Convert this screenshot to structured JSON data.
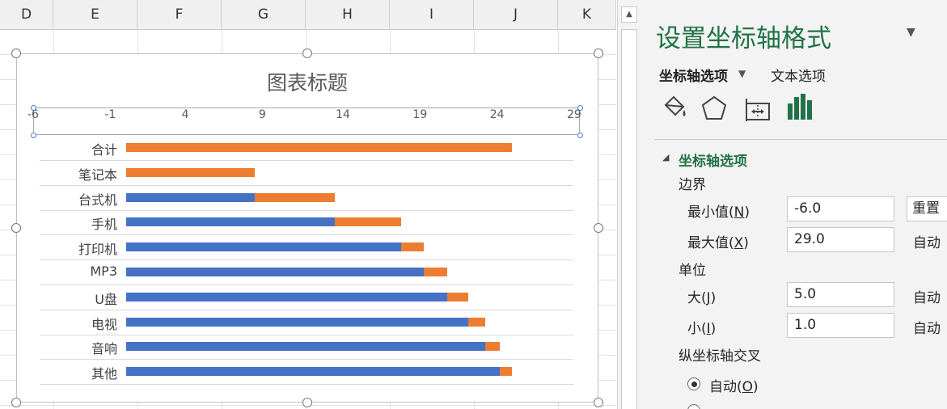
{
  "sheet": {
    "columns": [
      "D",
      "E",
      "F",
      "G",
      "H",
      "I",
      "J",
      "K"
    ]
  },
  "chart": {
    "title": "图表标题",
    "colors": {
      "series1": "#4472c4",
      "series2": "#ed7d31"
    }
  },
  "chart_data": {
    "type": "bar",
    "orientation": "horizontal",
    "stacked": true,
    "title": "图表标题",
    "xlim": [
      -6,
      29
    ],
    "x_ticks": [
      "-6",
      "-1",
      "4",
      "9",
      "14",
      "19",
      "24",
      "29"
    ],
    "categories": [
      "合计",
      "笔记本",
      "台式机",
      "手机",
      "打印机",
      "MP3",
      "U盘",
      "电视",
      "音响",
      "其他"
    ],
    "series": [
      {
        "values": [
          0,
          0,
          8.3,
          13.5,
          17.8,
          19.3,
          20.8,
          22.2,
          23.3,
          24.2
        ],
        "color": "#4472c4"
      },
      {
        "values": [
          25.0,
          8.3,
          5.2,
          4.3,
          1.5,
          1.5,
          1.4,
          1.1,
          0.9,
          0.8
        ],
        "color": "#ed7d31"
      }
    ],
    "grid": true,
    "legend": "none"
  },
  "pane": {
    "title": "设置坐标轴格式",
    "tab_axis": "坐标轴选项",
    "tab_text": "文本选项",
    "section_title": "坐标轴选项",
    "bounds_label": "边界",
    "min_label": "最小值(",
    "min_key": "N",
    "min_value": "-6.0",
    "reset_label": "重置",
    "max_label": "最大值(",
    "max_key": "X",
    "max_value": "29.0",
    "auto_label": "自动",
    "units_label": "单位",
    "major_label": "大(",
    "major_key": "J",
    "major_value": "5.0",
    "minor_label": "小(",
    "minor_key": "I",
    "minor_value": "1.0",
    "cross_label": "纵坐标轴交叉",
    "radio_auto_label": "自动(",
    "radio_auto_key": "O",
    "close_paren": ")",
    "icons": [
      "fill-line-icon",
      "effects-icon",
      "size-properties-icon",
      "axis-options-icon"
    ]
  }
}
